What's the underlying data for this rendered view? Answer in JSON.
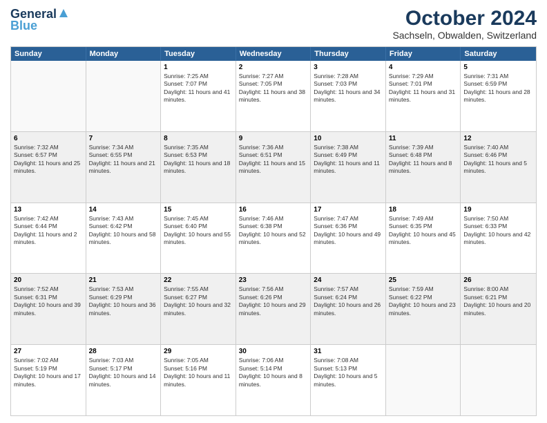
{
  "header": {
    "logo_line1": "General",
    "logo_line2": "Blue",
    "main_title": "October 2024",
    "subtitle": "Sachseln, Obwalden, Switzerland"
  },
  "weekdays": [
    "Sunday",
    "Monday",
    "Tuesday",
    "Wednesday",
    "Thursday",
    "Friday",
    "Saturday"
  ],
  "weeks": [
    [
      {
        "day": "",
        "info": ""
      },
      {
        "day": "",
        "info": ""
      },
      {
        "day": "1",
        "info": "Sunrise: 7:25 AM\nSunset: 7:07 PM\nDaylight: 11 hours and 41 minutes."
      },
      {
        "day": "2",
        "info": "Sunrise: 7:27 AM\nSunset: 7:05 PM\nDaylight: 11 hours and 38 minutes."
      },
      {
        "day": "3",
        "info": "Sunrise: 7:28 AM\nSunset: 7:03 PM\nDaylight: 11 hours and 34 minutes."
      },
      {
        "day": "4",
        "info": "Sunrise: 7:29 AM\nSunset: 7:01 PM\nDaylight: 11 hours and 31 minutes."
      },
      {
        "day": "5",
        "info": "Sunrise: 7:31 AM\nSunset: 6:59 PM\nDaylight: 11 hours and 28 minutes."
      }
    ],
    [
      {
        "day": "6",
        "info": "Sunrise: 7:32 AM\nSunset: 6:57 PM\nDaylight: 11 hours and 25 minutes."
      },
      {
        "day": "7",
        "info": "Sunrise: 7:34 AM\nSunset: 6:55 PM\nDaylight: 11 hours and 21 minutes."
      },
      {
        "day": "8",
        "info": "Sunrise: 7:35 AM\nSunset: 6:53 PM\nDaylight: 11 hours and 18 minutes."
      },
      {
        "day": "9",
        "info": "Sunrise: 7:36 AM\nSunset: 6:51 PM\nDaylight: 11 hours and 15 minutes."
      },
      {
        "day": "10",
        "info": "Sunrise: 7:38 AM\nSunset: 6:49 PM\nDaylight: 11 hours and 11 minutes."
      },
      {
        "day": "11",
        "info": "Sunrise: 7:39 AM\nSunset: 6:48 PM\nDaylight: 11 hours and 8 minutes."
      },
      {
        "day": "12",
        "info": "Sunrise: 7:40 AM\nSunset: 6:46 PM\nDaylight: 11 hours and 5 minutes."
      }
    ],
    [
      {
        "day": "13",
        "info": "Sunrise: 7:42 AM\nSunset: 6:44 PM\nDaylight: 11 hours and 2 minutes."
      },
      {
        "day": "14",
        "info": "Sunrise: 7:43 AM\nSunset: 6:42 PM\nDaylight: 10 hours and 58 minutes."
      },
      {
        "day": "15",
        "info": "Sunrise: 7:45 AM\nSunset: 6:40 PM\nDaylight: 10 hours and 55 minutes."
      },
      {
        "day": "16",
        "info": "Sunrise: 7:46 AM\nSunset: 6:38 PM\nDaylight: 10 hours and 52 minutes."
      },
      {
        "day": "17",
        "info": "Sunrise: 7:47 AM\nSunset: 6:36 PM\nDaylight: 10 hours and 49 minutes."
      },
      {
        "day": "18",
        "info": "Sunrise: 7:49 AM\nSunset: 6:35 PM\nDaylight: 10 hours and 45 minutes."
      },
      {
        "day": "19",
        "info": "Sunrise: 7:50 AM\nSunset: 6:33 PM\nDaylight: 10 hours and 42 minutes."
      }
    ],
    [
      {
        "day": "20",
        "info": "Sunrise: 7:52 AM\nSunset: 6:31 PM\nDaylight: 10 hours and 39 minutes."
      },
      {
        "day": "21",
        "info": "Sunrise: 7:53 AM\nSunset: 6:29 PM\nDaylight: 10 hours and 36 minutes."
      },
      {
        "day": "22",
        "info": "Sunrise: 7:55 AM\nSunset: 6:27 PM\nDaylight: 10 hours and 32 minutes."
      },
      {
        "day": "23",
        "info": "Sunrise: 7:56 AM\nSunset: 6:26 PM\nDaylight: 10 hours and 29 minutes."
      },
      {
        "day": "24",
        "info": "Sunrise: 7:57 AM\nSunset: 6:24 PM\nDaylight: 10 hours and 26 minutes."
      },
      {
        "day": "25",
        "info": "Sunrise: 7:59 AM\nSunset: 6:22 PM\nDaylight: 10 hours and 23 minutes."
      },
      {
        "day": "26",
        "info": "Sunrise: 8:00 AM\nSunset: 6:21 PM\nDaylight: 10 hours and 20 minutes."
      }
    ],
    [
      {
        "day": "27",
        "info": "Sunrise: 7:02 AM\nSunset: 5:19 PM\nDaylight: 10 hours and 17 minutes."
      },
      {
        "day": "28",
        "info": "Sunrise: 7:03 AM\nSunset: 5:17 PM\nDaylight: 10 hours and 14 minutes."
      },
      {
        "day": "29",
        "info": "Sunrise: 7:05 AM\nSunset: 5:16 PM\nDaylight: 10 hours and 11 minutes."
      },
      {
        "day": "30",
        "info": "Sunrise: 7:06 AM\nSunset: 5:14 PM\nDaylight: 10 hours and 8 minutes."
      },
      {
        "day": "31",
        "info": "Sunrise: 7:08 AM\nSunset: 5:13 PM\nDaylight: 10 hours and 5 minutes."
      },
      {
        "day": "",
        "info": ""
      },
      {
        "day": "",
        "info": ""
      }
    ]
  ]
}
